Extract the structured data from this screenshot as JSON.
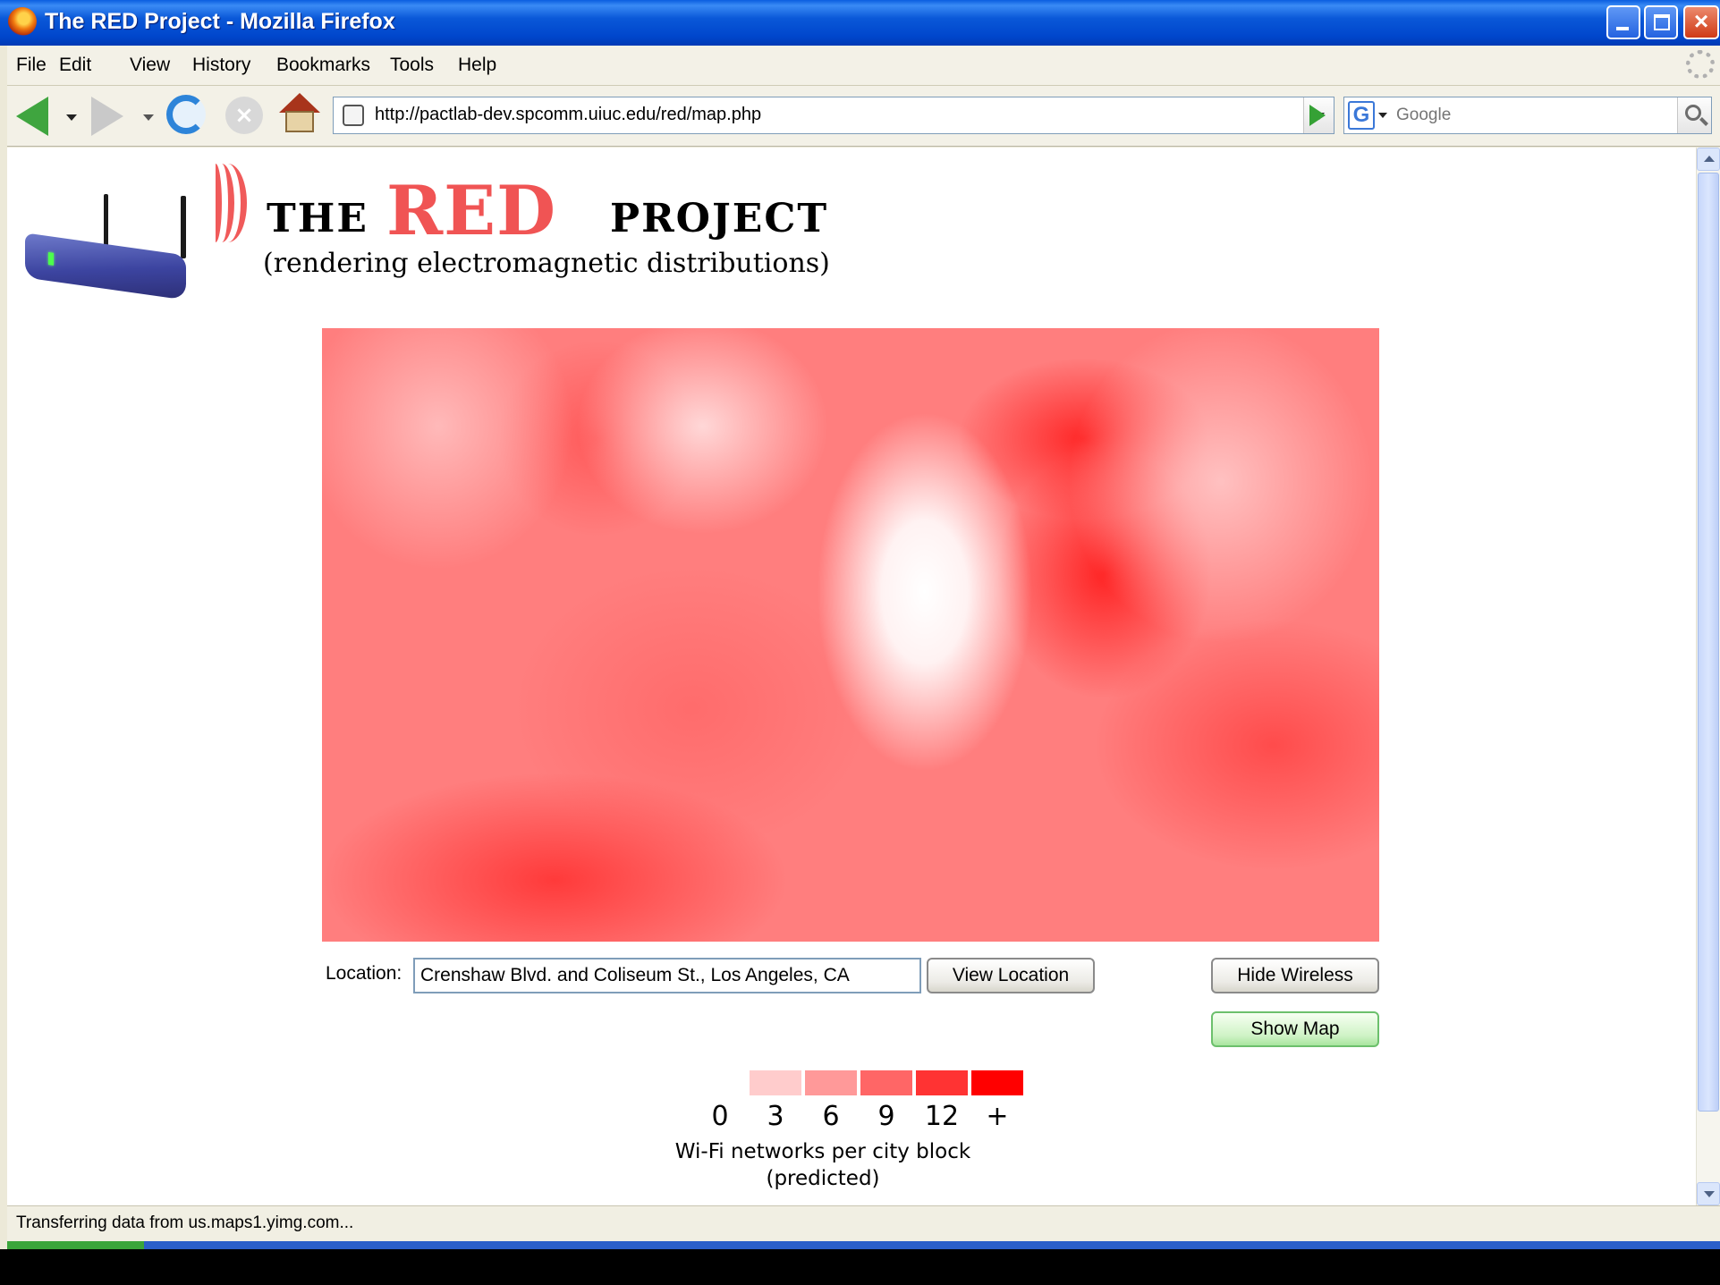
{
  "window": {
    "title": "The RED Project - Mozilla Firefox"
  },
  "menu": [
    "File",
    "Edit",
    "View",
    "History",
    "Bookmarks",
    "Tools",
    "Help"
  ],
  "navbar": {
    "url": "http://pactlab-dev.spcomm.uiuc.edu/red/map.php",
    "search_placeholder": "Google",
    "search_engine": "G"
  },
  "logo": {
    "the": "THE",
    "red": "RED",
    "project": "PROJECT",
    "tagline": "(rendering electromagnetic distributions)"
  },
  "controls": {
    "location_label": "Location:",
    "location_value": "Crenshaw Blvd. and Coliseum St., Los Angeles, CA",
    "view_location": "View Location",
    "hide_wireless": "Hide Wireless",
    "show_map": "Show Map"
  },
  "legend": {
    "ticks": [
      "0",
      "3",
      "6",
      "9",
      "12",
      "+"
    ],
    "colors": [
      "#ffcccc",
      "#ff9999",
      "#ff6666",
      "#ff3333",
      "#ff0000"
    ],
    "caption_line1": "Wi-Fi networks per city block",
    "caption_line2": "(predicted)"
  },
  "status": {
    "text": "Transferring data from us.maps1.yimg.com..."
  },
  "icons": {
    "app": "firefox-icon",
    "back": "back-arrow-icon",
    "forward": "forward-arrow-icon",
    "reload": "reload-icon",
    "stop": "stop-icon",
    "home": "home-icon",
    "go": "go-arrow-icon",
    "search": "magnifier-icon"
  }
}
